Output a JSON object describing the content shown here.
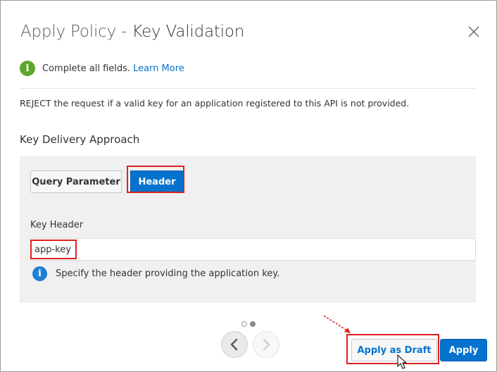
{
  "dialog": {
    "title_part1": "Apply Policy",
    "title_sep": " - ",
    "title_part2": "Key Validation",
    "close_icon": "close-icon"
  },
  "info": {
    "icon": "info-icon",
    "text": "Complete all fields.",
    "link": "Learn More"
  },
  "description": "REJECT the request if a valid key for an application registered to this API is not provided.",
  "key_delivery": {
    "title": "Key Delivery Approach",
    "options": [
      "Query Parameter",
      "Header"
    ],
    "selected": "Header",
    "field_label": "Key Header",
    "field_value": "app-key",
    "hint": "Specify the header providing the application key."
  },
  "pagination": {
    "total": 2,
    "current": 2
  },
  "footer": {
    "draft_label": "Apply as Draft",
    "apply_label": "Apply"
  },
  "colors": {
    "accent": "#0572ce",
    "success": "#5fa62c",
    "highlight": "#e02020"
  }
}
